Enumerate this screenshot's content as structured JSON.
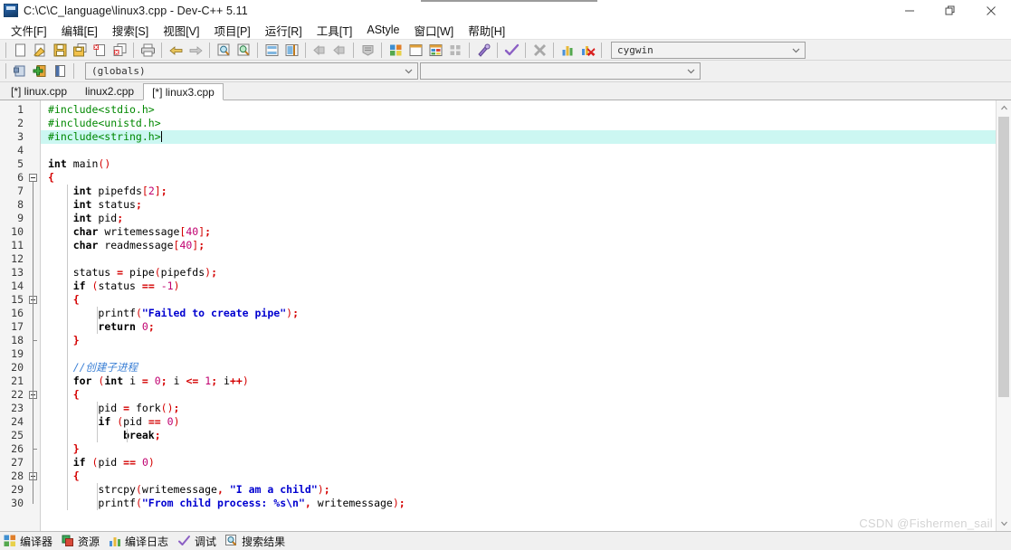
{
  "window": {
    "title": "C:\\C\\C_language\\linux3.cpp - Dev-C++ 5.11",
    "icon": "devcpp-logo-icon",
    "controls": {
      "minimize": "minimize-icon",
      "restore": "restore-icon",
      "close": "close-icon"
    }
  },
  "menubar": {
    "items": [
      {
        "label": "文件[F]",
        "name": "menu-file"
      },
      {
        "label": "编辑[E]",
        "name": "menu-edit"
      },
      {
        "label": "搜索[S]",
        "name": "menu-search"
      },
      {
        "label": "视图[V]",
        "name": "menu-view"
      },
      {
        "label": "项目[P]",
        "name": "menu-project"
      },
      {
        "label": "运行[R]",
        "name": "menu-run"
      },
      {
        "label": "工具[T]",
        "name": "menu-tools"
      },
      {
        "label": "AStyle",
        "name": "menu-astyle"
      },
      {
        "label": "窗口[W]",
        "name": "menu-window"
      },
      {
        "label": "帮助[H]",
        "name": "menu-help"
      }
    ]
  },
  "toolbar": {
    "row1": [
      {
        "name": "new-file-button",
        "icon": "new-file-icon"
      },
      {
        "name": "open-file-button",
        "icon": "open-folder-icon"
      },
      {
        "name": "save-button",
        "icon": "save-disk-icon"
      },
      {
        "name": "save-all-button",
        "icon": "save-all-icon"
      },
      {
        "name": "close-file-button",
        "icon": "close-file-icon"
      },
      {
        "name": "close-all-button",
        "icon": "close-all-icon"
      },
      {
        "name": "print-button",
        "icon": "printer-icon"
      },
      {
        "name": "undo-button",
        "icon": "undo-arrow-icon"
      },
      {
        "name": "redo-button",
        "icon": "redo-arrow-icon"
      },
      {
        "name": "find-button",
        "icon": "magnifier-icon"
      },
      {
        "name": "replace-button",
        "icon": "magnifier-replace-icon"
      },
      {
        "name": "goto-line-button",
        "icon": "goto-line-icon"
      },
      {
        "name": "goto-function-button",
        "icon": "goto-function-icon"
      },
      {
        "name": "back-button",
        "icon": "nav-back-icon"
      },
      {
        "name": "forward-button",
        "icon": "nav-forward-icon"
      },
      {
        "name": "bookmark-button",
        "icon": "bookmark-icon"
      },
      {
        "name": "compile-button",
        "icon": "compile-grid-icon"
      },
      {
        "name": "run-button",
        "icon": "run-window-icon"
      },
      {
        "name": "compile-run-button",
        "icon": "compile-run-icon"
      },
      {
        "name": "rebuild-all-button",
        "icon": "rebuild-all-icon"
      },
      {
        "name": "debug-button",
        "icon": "debug-wrench-icon"
      },
      {
        "name": "syntax-check-button",
        "icon": "check-mark-icon"
      },
      {
        "name": "stop-execution-button",
        "icon": "stop-x-icon"
      },
      {
        "name": "profile-button",
        "icon": "profile-chart-icon"
      },
      {
        "name": "delete-profile-button",
        "icon": "delete-profile-icon"
      }
    ],
    "row2": [
      {
        "name": "insert-button",
        "icon": "insert-icon"
      },
      {
        "name": "toggle-breakpoint-button",
        "icon": "add-green-icon"
      },
      {
        "name": "toggle-panel-button",
        "icon": "panel-toggle-icon"
      }
    ],
    "compiler_select": {
      "value": "cygwin",
      "name": "compiler-set-select",
      "caret": "chevron-down-icon"
    },
    "globals_select": {
      "value": "(globals)",
      "name": "scope-globals-select",
      "caret": "chevron-down-icon"
    },
    "class_select": {
      "value": "",
      "name": "class-browser-select",
      "caret": "chevron-down-icon"
    }
  },
  "tabs": [
    {
      "label": "[*] linux.cpp",
      "name": "tab-linux-cpp",
      "active": false
    },
    {
      "label": "linux2.cpp",
      "name": "tab-linux2-cpp",
      "active": false
    },
    {
      "label": "[*] linux3.cpp",
      "name": "tab-linux3-cpp",
      "active": true
    }
  ],
  "editor": {
    "current_line": 3,
    "line_numbers": [
      1,
      2,
      3,
      4,
      5,
      6,
      7,
      8,
      9,
      10,
      11,
      12,
      13,
      14,
      15,
      16,
      17,
      18,
      19,
      20,
      21,
      22,
      23,
      24,
      25,
      26,
      27,
      28,
      29,
      30
    ],
    "lines": [
      {
        "n": 1,
        "tokens": [
          {
            "t": "#include<stdio.h>",
            "c": "pp"
          }
        ]
      },
      {
        "n": 2,
        "tokens": [
          {
            "t": "#include<unistd.h>",
            "c": "pp"
          }
        ]
      },
      {
        "n": 3,
        "tokens": [
          {
            "t": "#include<string.h>",
            "c": "pp"
          }
        ],
        "caret": true
      },
      {
        "n": 4,
        "tokens": []
      },
      {
        "n": 5,
        "tokens": [
          {
            "t": "int",
            "c": "k"
          },
          {
            "t": " main",
            "c": "id"
          },
          {
            "t": "()",
            "c": "br"
          }
        ]
      },
      {
        "n": 6,
        "tokens": [
          {
            "t": "{",
            "c": "op"
          }
        ],
        "fold": "start"
      },
      {
        "n": 7,
        "tokens": [
          {
            "t": "    ",
            "c": "id"
          },
          {
            "t": "int",
            "c": "k"
          },
          {
            "t": " pipefds",
            "c": "id"
          },
          {
            "t": "[",
            "c": "br"
          },
          {
            "t": "2",
            "c": "nu"
          },
          {
            "t": "]",
            "c": "br"
          },
          {
            "t": ";",
            "c": "op"
          }
        ]
      },
      {
        "n": 8,
        "tokens": [
          {
            "t": "    ",
            "c": "id"
          },
          {
            "t": "int",
            "c": "k"
          },
          {
            "t": " status",
            "c": "id"
          },
          {
            "t": ";",
            "c": "op"
          }
        ]
      },
      {
        "n": 9,
        "tokens": [
          {
            "t": "    ",
            "c": "id"
          },
          {
            "t": "int",
            "c": "k"
          },
          {
            "t": " pid",
            "c": "id"
          },
          {
            "t": ";",
            "c": "op"
          }
        ]
      },
      {
        "n": 10,
        "tokens": [
          {
            "t": "    ",
            "c": "id"
          },
          {
            "t": "char",
            "c": "k"
          },
          {
            "t": " writemessage",
            "c": "id"
          },
          {
            "t": "[",
            "c": "br"
          },
          {
            "t": "40",
            "c": "nu"
          },
          {
            "t": "]",
            "c": "br"
          },
          {
            "t": ";",
            "c": "op"
          }
        ]
      },
      {
        "n": 11,
        "tokens": [
          {
            "t": "    ",
            "c": "id"
          },
          {
            "t": "char",
            "c": "k"
          },
          {
            "t": " readmessage",
            "c": "id"
          },
          {
            "t": "[",
            "c": "br"
          },
          {
            "t": "40",
            "c": "nu"
          },
          {
            "t": "]",
            "c": "br"
          },
          {
            "t": ";",
            "c": "op"
          }
        ]
      },
      {
        "n": 12,
        "tokens": []
      },
      {
        "n": 13,
        "tokens": [
          {
            "t": "    status ",
            "c": "id"
          },
          {
            "t": "=",
            "c": "op"
          },
          {
            "t": " pipe",
            "c": "id"
          },
          {
            "t": "(",
            "c": "br"
          },
          {
            "t": "pipefds",
            "c": "id"
          },
          {
            "t": ")",
            "c": "br"
          },
          {
            "t": ";",
            "c": "op"
          }
        ]
      },
      {
        "n": 14,
        "tokens": [
          {
            "t": "    ",
            "c": "id"
          },
          {
            "t": "if",
            "c": "k"
          },
          {
            "t": " ",
            "c": "id"
          },
          {
            "t": "(",
            "c": "br"
          },
          {
            "t": "status ",
            "c": "id"
          },
          {
            "t": "==",
            "c": "op"
          },
          {
            "t": " ",
            "c": "id"
          },
          {
            "t": "-1",
            "c": "nu"
          },
          {
            "t": ")",
            "c": "br"
          }
        ]
      },
      {
        "n": 15,
        "tokens": [
          {
            "t": "    ",
            "c": "id"
          },
          {
            "t": "{",
            "c": "op"
          }
        ],
        "fold": "start"
      },
      {
        "n": 16,
        "tokens": [
          {
            "t": "        printf",
            "c": "id"
          },
          {
            "t": "(",
            "c": "br"
          },
          {
            "t": "\"Failed to create pipe\"",
            "c": "st"
          },
          {
            "t": ")",
            "c": "br"
          },
          {
            "t": ";",
            "c": "op"
          }
        ]
      },
      {
        "n": 17,
        "tokens": [
          {
            "t": "        ",
            "c": "id"
          },
          {
            "t": "return",
            "c": "k"
          },
          {
            "t": " ",
            "c": "id"
          },
          {
            "t": "0",
            "c": "nu"
          },
          {
            "t": ";",
            "c": "op"
          }
        ]
      },
      {
        "n": 18,
        "tokens": [
          {
            "t": "    ",
            "c": "id"
          },
          {
            "t": "}",
            "c": "op"
          }
        ],
        "fold": "end"
      },
      {
        "n": 19,
        "tokens": []
      },
      {
        "n": 20,
        "tokens": [
          {
            "t": "    //创建子进程",
            "c": "cm"
          }
        ]
      },
      {
        "n": 21,
        "tokens": [
          {
            "t": "    ",
            "c": "id"
          },
          {
            "t": "for",
            "c": "k"
          },
          {
            "t": " ",
            "c": "id"
          },
          {
            "t": "(",
            "c": "br"
          },
          {
            "t": "int",
            "c": "k"
          },
          {
            "t": " i ",
            "c": "id"
          },
          {
            "t": "=",
            "c": "op"
          },
          {
            "t": " ",
            "c": "id"
          },
          {
            "t": "0",
            "c": "nu"
          },
          {
            "t": ";",
            "c": "op"
          },
          {
            "t": " i ",
            "c": "id"
          },
          {
            "t": "<=",
            "c": "op"
          },
          {
            "t": " ",
            "c": "id"
          },
          {
            "t": "1",
            "c": "nu"
          },
          {
            "t": ";",
            "c": "op"
          },
          {
            "t": " i",
            "c": "id"
          },
          {
            "t": "++",
            "c": "op"
          },
          {
            "t": ")",
            "c": "br"
          }
        ]
      },
      {
        "n": 22,
        "tokens": [
          {
            "t": "    ",
            "c": "id"
          },
          {
            "t": "{",
            "c": "op"
          }
        ],
        "fold": "start"
      },
      {
        "n": 23,
        "tokens": [
          {
            "t": "        pid ",
            "c": "id"
          },
          {
            "t": "=",
            "c": "op"
          },
          {
            "t": " fork",
            "c": "id"
          },
          {
            "t": "()",
            "c": "br"
          },
          {
            "t": ";",
            "c": "op"
          }
        ]
      },
      {
        "n": 24,
        "tokens": [
          {
            "t": "        ",
            "c": "id"
          },
          {
            "t": "if",
            "c": "k"
          },
          {
            "t": " ",
            "c": "id"
          },
          {
            "t": "(",
            "c": "br"
          },
          {
            "t": "pid ",
            "c": "id"
          },
          {
            "t": "==",
            "c": "op"
          },
          {
            "t": " ",
            "c": "id"
          },
          {
            "t": "0",
            "c": "nu"
          },
          {
            "t": ")",
            "c": "br"
          }
        ]
      },
      {
        "n": 25,
        "tokens": [
          {
            "t": "            ",
            "c": "id"
          },
          {
            "t": "break",
            "c": "k"
          },
          {
            "t": ";",
            "c": "op"
          }
        ]
      },
      {
        "n": 26,
        "tokens": [
          {
            "t": "    ",
            "c": "id"
          },
          {
            "t": "}",
            "c": "op"
          }
        ],
        "fold": "end"
      },
      {
        "n": 27,
        "tokens": [
          {
            "t": "    ",
            "c": "id"
          },
          {
            "t": "if",
            "c": "k"
          },
          {
            "t": " ",
            "c": "id"
          },
          {
            "t": "(",
            "c": "br"
          },
          {
            "t": "pid ",
            "c": "id"
          },
          {
            "t": "==",
            "c": "op"
          },
          {
            "t": " ",
            "c": "id"
          },
          {
            "t": "0",
            "c": "nu"
          },
          {
            "t": ")",
            "c": "br"
          }
        ]
      },
      {
        "n": 28,
        "tokens": [
          {
            "t": "    ",
            "c": "id"
          },
          {
            "t": "{",
            "c": "op"
          }
        ],
        "fold": "start"
      },
      {
        "n": 29,
        "tokens": [
          {
            "t": "        strcpy",
            "c": "id"
          },
          {
            "t": "(",
            "c": "br"
          },
          {
            "t": "writemessage",
            "c": "id"
          },
          {
            "t": ",",
            "c": "op"
          },
          {
            "t": " ",
            "c": "id"
          },
          {
            "t": "\"I am a child\"",
            "c": "st"
          },
          {
            "t": ")",
            "c": "br"
          },
          {
            "t": ";",
            "c": "op"
          }
        ]
      },
      {
        "n": 30,
        "tokens": [
          {
            "t": "        printf",
            "c": "id"
          },
          {
            "t": "(",
            "c": "br"
          },
          {
            "t": "\"From child process: %s\\n\"",
            "c": "st"
          },
          {
            "t": ",",
            "c": "op"
          },
          {
            "t": " writemessage",
            "c": "id"
          },
          {
            "t": ")",
            "c": "br"
          },
          {
            "t": ";",
            "c": "op"
          }
        ]
      }
    ]
  },
  "bottom_panel": {
    "items": [
      {
        "label": "编译器",
        "name": "panel-tab-compiler",
        "icon": "compiler-grid-icon"
      },
      {
        "label": "资源",
        "name": "panel-tab-resources",
        "icon": "resources-icon"
      },
      {
        "label": "编译日志",
        "name": "panel-tab-compile-log",
        "icon": "log-chart-icon"
      },
      {
        "label": "调试",
        "name": "panel-tab-debug",
        "icon": "check-mark-icon"
      },
      {
        "label": "搜索结果",
        "name": "panel-tab-search-results",
        "icon": "search-results-icon"
      }
    ]
  },
  "watermark": {
    "text": "CSDN @Fishermen_sail"
  },
  "colors": {
    "keyword": "#000000",
    "preprocessor": "#008800",
    "string": "#0000d0",
    "number": "#c00070",
    "operator": "#d40000",
    "comment": "#3a7fd5",
    "current_line_bg": "#ccf7f2",
    "toolbar_bg": "#f0f0f0",
    "editor_bg": "#ffffff"
  }
}
